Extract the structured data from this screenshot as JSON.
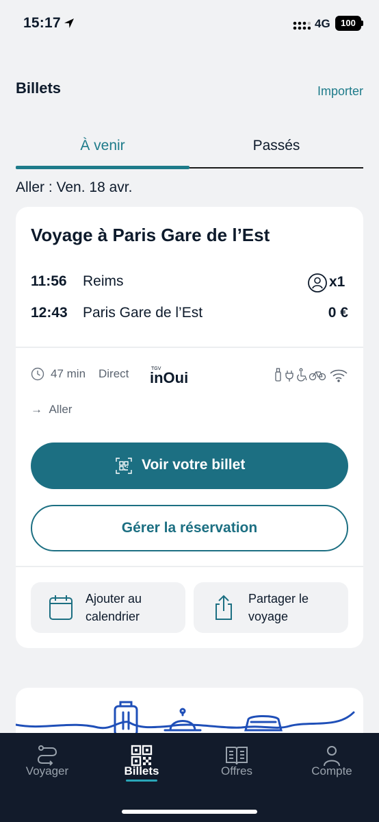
{
  "status": {
    "time": "15:17",
    "network": "4G",
    "battery": "100"
  },
  "header": {
    "title": "Billets",
    "import_label": "Importer"
  },
  "tabs": [
    {
      "label": "À venir"
    },
    {
      "label": "Passés"
    }
  ],
  "date_line": "Aller : Ven. 18 avr.",
  "trip": {
    "title": "Voyage à Paris Gare de l’Est",
    "departure": {
      "time": "11:56",
      "station": "Reims"
    },
    "arrival": {
      "time": "12:43",
      "station": "Paris Gare de l’Est"
    },
    "passengers": "x1",
    "price": "0 €",
    "duration": "47 min",
    "type": "Direct",
    "brand_top": "TGV",
    "brand": "inOui",
    "direction": "Aller",
    "amenity_icons": [
      "bottle-icon",
      "power-plug-icon",
      "wheelchair-icon",
      "bike-icon",
      "wifi-icon"
    ]
  },
  "actions": {
    "view_ticket": "Voir votre billet",
    "manage": "Gérer la réservation",
    "add_calendar": "Ajouter au calendrier",
    "share": "Partager le voyage"
  },
  "tabbar": [
    {
      "label": "Voyager",
      "icon": "route-icon"
    },
    {
      "label": "Billets",
      "icon": "qr-ticket-icon"
    },
    {
      "label": "Offres",
      "icon": "book-icon"
    },
    {
      "label": "Compte",
      "icon": "user-icon"
    }
  ],
  "colors": {
    "accent": "#1e7b8a",
    "button": "#1c6f82",
    "tabbar": "#121b2b",
    "background": "#f1f2f4"
  }
}
